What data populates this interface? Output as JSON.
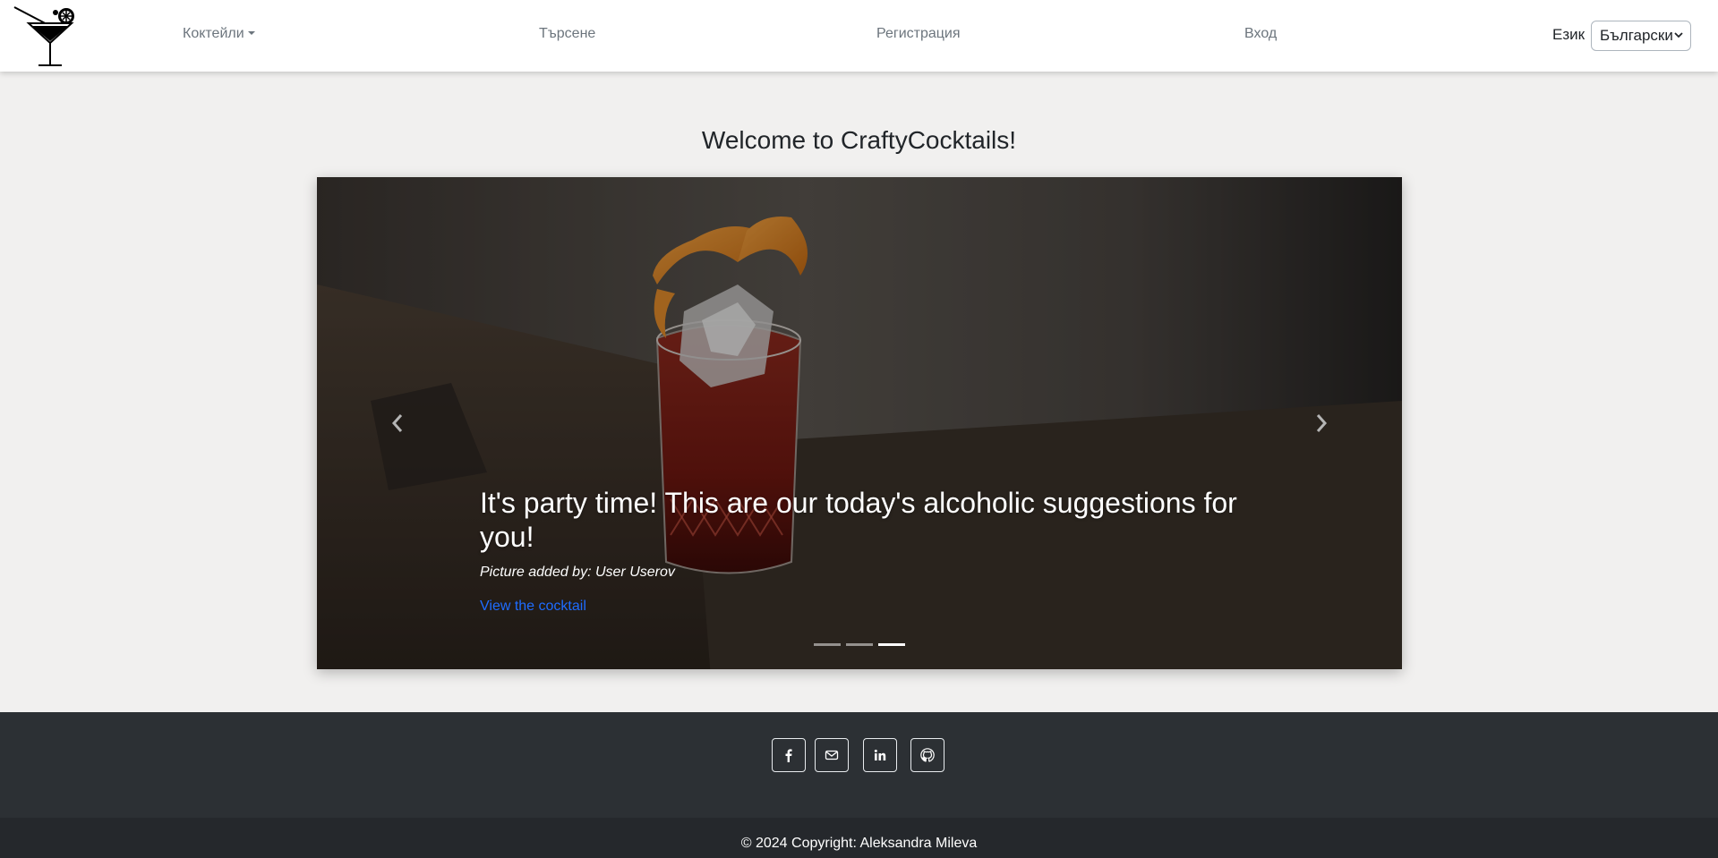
{
  "navbar": {
    "logo_icon": "cocktail-glass-logo",
    "cocktails_label": "Коктейли",
    "search_label": "Търсене",
    "register_label": "Регистрация",
    "login_label": "Вход",
    "language_label": "Език",
    "language_selected": "Български"
  },
  "page": {
    "welcome_title": "Welcome to CraftyCocktails!"
  },
  "carousel": {
    "caption_title": "It's party time! This are our today's alcoholic suggestions for you!",
    "caption_author": "Picture added by: User Userov",
    "caption_link": "View the cocktail",
    "slide_count": 3,
    "active_slide": 3,
    "link_color": "#1e6cff"
  },
  "footer": {
    "social_icons": [
      "facebook-icon",
      "mail-icon",
      "linkedin-icon",
      "github-icon"
    ],
    "copyright": "© 2024 Copyright: Aleksandra Mileva",
    "background": "#2c3034"
  }
}
